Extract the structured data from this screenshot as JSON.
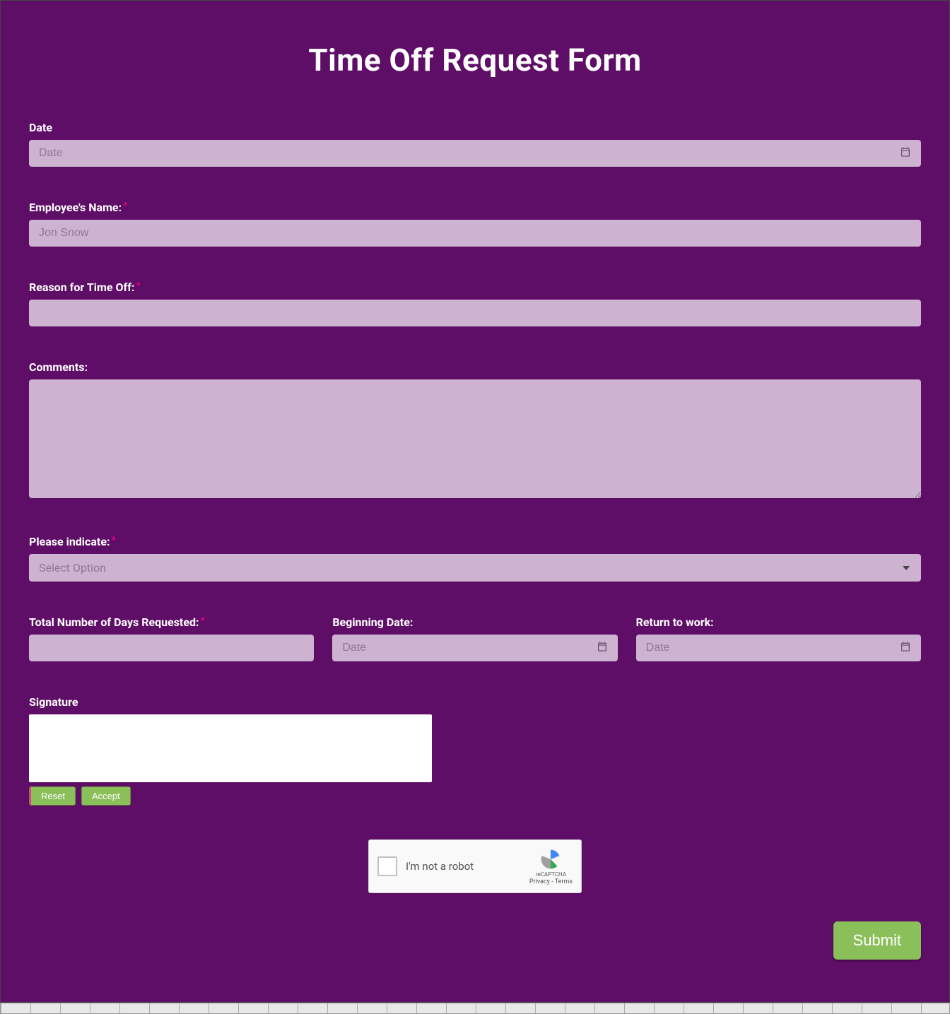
{
  "title": "Time Off Request Form",
  "fields": {
    "date": {
      "label": "Date",
      "placeholder": "Date",
      "required": false
    },
    "employee_name": {
      "label": "Employee's Name:",
      "placeholder": "Jon Snow",
      "required": true
    },
    "reason": {
      "label": "Reason for Time Off:",
      "placeholder": "",
      "required": true
    },
    "comments": {
      "label": "Comments:",
      "placeholder": "",
      "required": false
    },
    "indicate": {
      "label": "Please indicate:",
      "placeholder": "Select Option",
      "required": true
    },
    "days_requested": {
      "label": "Total Number of Days Requested:",
      "placeholder": "",
      "required": true
    },
    "beginning_date": {
      "label": "Beginning Date:",
      "placeholder": "Date",
      "required": false
    },
    "return_date": {
      "label": "Return to work:",
      "placeholder": "Date",
      "required": false
    },
    "signature": {
      "label": "Signature"
    }
  },
  "buttons": {
    "reset": "Reset",
    "accept": "Accept",
    "submit": "Submit"
  },
  "captcha": {
    "text": "I'm not a robot",
    "brand": "reCAPTCHA",
    "links": "Privacy - Terms"
  },
  "required_marker": "*"
}
